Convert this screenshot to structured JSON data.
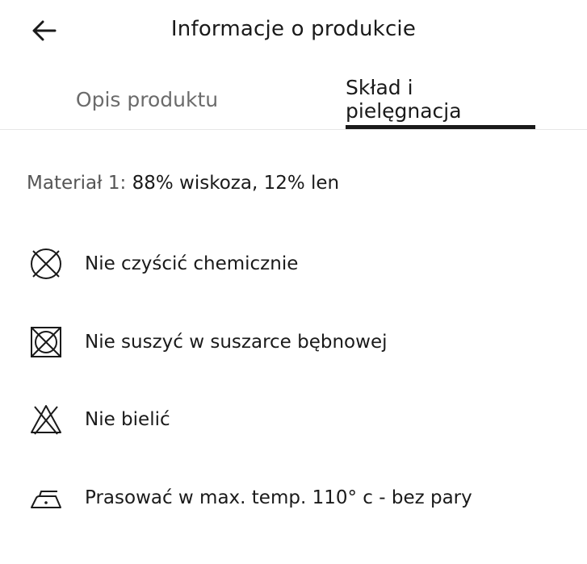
{
  "header": {
    "title": "Informacje o produkcie",
    "back_icon": "arrow-left-icon"
  },
  "tabs": [
    {
      "label": "Opis produktu",
      "active": false
    },
    {
      "label": "Skład i pielęgnacja",
      "active": true
    }
  ],
  "composition": {
    "label": "Materiał 1:",
    "value": "88% wiskoza, 12% len"
  },
  "care": [
    {
      "icon": "no-dry-clean-icon",
      "text": "Nie czyścić chemicznie"
    },
    {
      "icon": "no-tumble-dry-icon",
      "text": "Nie suszyć w suszarce bębnowej"
    },
    {
      "icon": "no-bleach-icon",
      "text": "Nie bielić"
    },
    {
      "icon": "iron-low-temp-icon",
      "text": "Prasować w max. temp. 110° c - bez pary"
    }
  ],
  "colors": {
    "text_primary": "#1a1a1a",
    "text_secondary": "#6b6b6b",
    "divider": "#e6e6e6",
    "background": "#ffffff"
  }
}
